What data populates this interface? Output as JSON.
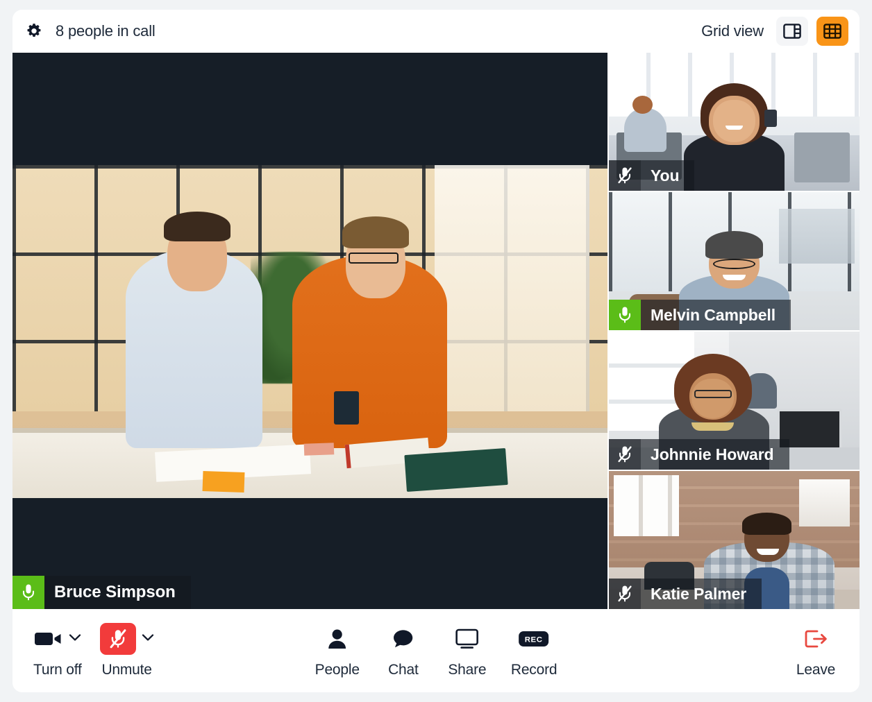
{
  "header": {
    "settings_icon": "gear-icon",
    "title": "8 people in call",
    "view_label": "Grid view",
    "view_options": [
      {
        "name": "sidebar-view",
        "icon": "sidebar-layout-icon",
        "active": false
      },
      {
        "name": "grid-view",
        "icon": "grid-layout-icon",
        "active": true
      }
    ],
    "accent_color": "#f99417"
  },
  "main_speaker": {
    "name": "Bruce Simpson",
    "mic_state": "unmuted",
    "mic_icon": "microphone-icon",
    "mic_badge_color": "#5bbd18",
    "scene_description": "Two men seated at a table in a modern office with glass walls"
  },
  "participants": [
    {
      "name": "You",
      "mic_state": "muted",
      "mic_icon": "microphone-muted-icon",
      "scene_description": "Woman wearing a headset in a bright open-plan office"
    },
    {
      "name": "Melvin Campbell",
      "mic_state": "unmuted",
      "mic_icon": "microphone-icon",
      "scene_description": "Man in beanie and glasses smiling in a cafe"
    },
    {
      "name": "Johnnie Howard",
      "mic_state": "muted",
      "mic_icon": "microphone-muted-icon",
      "scene_description": "Woman with curly hair in a grey top in an office"
    },
    {
      "name": "Katie Palmer",
      "mic_state": "muted",
      "mic_icon": "microphone-muted-icon",
      "scene_description": "Man in a plaid shirt smiling in a loft workspace"
    }
  ],
  "toolbar": {
    "left": [
      {
        "label": "Turn off",
        "icon": "video-camera-icon",
        "has_chevron": true,
        "state": "on"
      },
      {
        "label": "Unmute",
        "icon": "microphone-muted-icon",
        "has_chevron": true,
        "state": "muted",
        "color": "#f23b3b"
      }
    ],
    "center": [
      {
        "label": "People",
        "icon": "person-icon"
      },
      {
        "label": "Chat",
        "icon": "chat-bubble-icon"
      },
      {
        "label": "Share",
        "icon": "screen-share-icon"
      },
      {
        "label": "Record",
        "icon": "record-badge-icon"
      }
    ],
    "right": [
      {
        "label": "Leave",
        "icon": "leave-call-icon",
        "color": "#e8483f"
      }
    ]
  }
}
